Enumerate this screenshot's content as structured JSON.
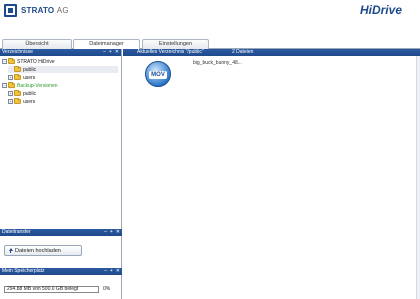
{
  "header": {
    "logo_brand": "STRATO",
    "logo_suffix": "AG",
    "product": "HiDrive"
  },
  "tabs": [
    {
      "label": "Übersicht",
      "active": false
    },
    {
      "label": "Dateimanager",
      "active": true
    },
    {
      "label": "Einstellungen",
      "active": false
    }
  ],
  "sidebar": {
    "title": "Verzeichnisse",
    "controls": [
      "–",
      "+",
      "✕"
    ],
    "tree": [
      {
        "label": "STRATO HiDrive",
        "expander": "−"
      },
      {
        "label": "public",
        "expander": "",
        "selected": true
      },
      {
        "label": "users",
        "expander": "+"
      },
      {
        "label": "Backup-Versionen",
        "expander": "−"
      },
      {
        "label": "public",
        "expander": "+"
      },
      {
        "label": "users",
        "expander": "+"
      }
    ],
    "transfer": {
      "title": "Dateitransfer",
      "upload_label": "Dateien hochladen"
    },
    "storage": {
      "title": "Mein Speicherplatz",
      "quota_text": "294.88 MB von 500.0 GB belegt",
      "percent": "0%"
    }
  },
  "main": {
    "header_title": "Aktuelles Verzeichnis \"/public\"",
    "header_count": "2 Dateien",
    "files": [
      {
        "name": "big_buck_bunny_48...",
        "icon_label": "MOV"
      }
    ]
  },
  "colors": {
    "brand_blue": "#1e4a8c",
    "folder_yellow": "#f2c240",
    "backup_green": "#2e9a2e"
  }
}
